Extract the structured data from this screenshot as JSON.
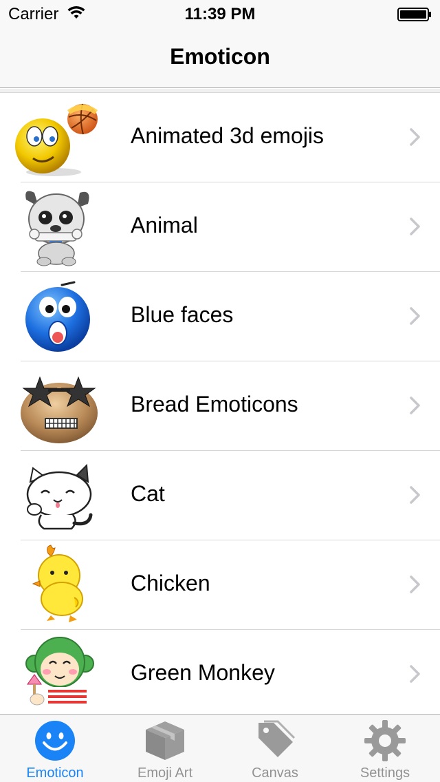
{
  "status_bar": {
    "carrier": "Carrier",
    "time": "11:39 PM",
    "wifi_icon": "wifi-icon",
    "battery_icon": "battery-full-icon"
  },
  "nav": {
    "title": "Emoticon"
  },
  "list": {
    "items": [
      {
        "label": "Animated 3d emojis",
        "icon": "yellow-3d-emoji-basketball-icon"
      },
      {
        "label": "Animal",
        "icon": "cartoon-dog-bone-icon"
      },
      {
        "label": "Blue faces",
        "icon": "blue-scared-face-icon"
      },
      {
        "label": "Bread Emoticons",
        "icon": "bread-face-star-glasses-icon"
      },
      {
        "label": "Cat",
        "icon": "white-cartoon-cat-icon"
      },
      {
        "label": "Chicken",
        "icon": "yellow-chick-icon"
      },
      {
        "label": "Green Monkey",
        "icon": "green-monkey-icecream-icon"
      }
    ],
    "chevron_icon": "chevron-right-icon"
  },
  "tab_bar": {
    "tabs": [
      {
        "label": "Emoticon",
        "icon": "smiley-face-icon",
        "active": true
      },
      {
        "label": "Emoji Art",
        "icon": "box-icon",
        "active": false
      },
      {
        "label": "Canvas",
        "icon": "tag-icon",
        "active": false
      },
      {
        "label": "Settings",
        "icon": "gear-icon",
        "active": false
      }
    ]
  },
  "colors": {
    "accent": "#1a84f6",
    "inactive_tab": "#929292",
    "chevron": "#c7c7cc"
  }
}
